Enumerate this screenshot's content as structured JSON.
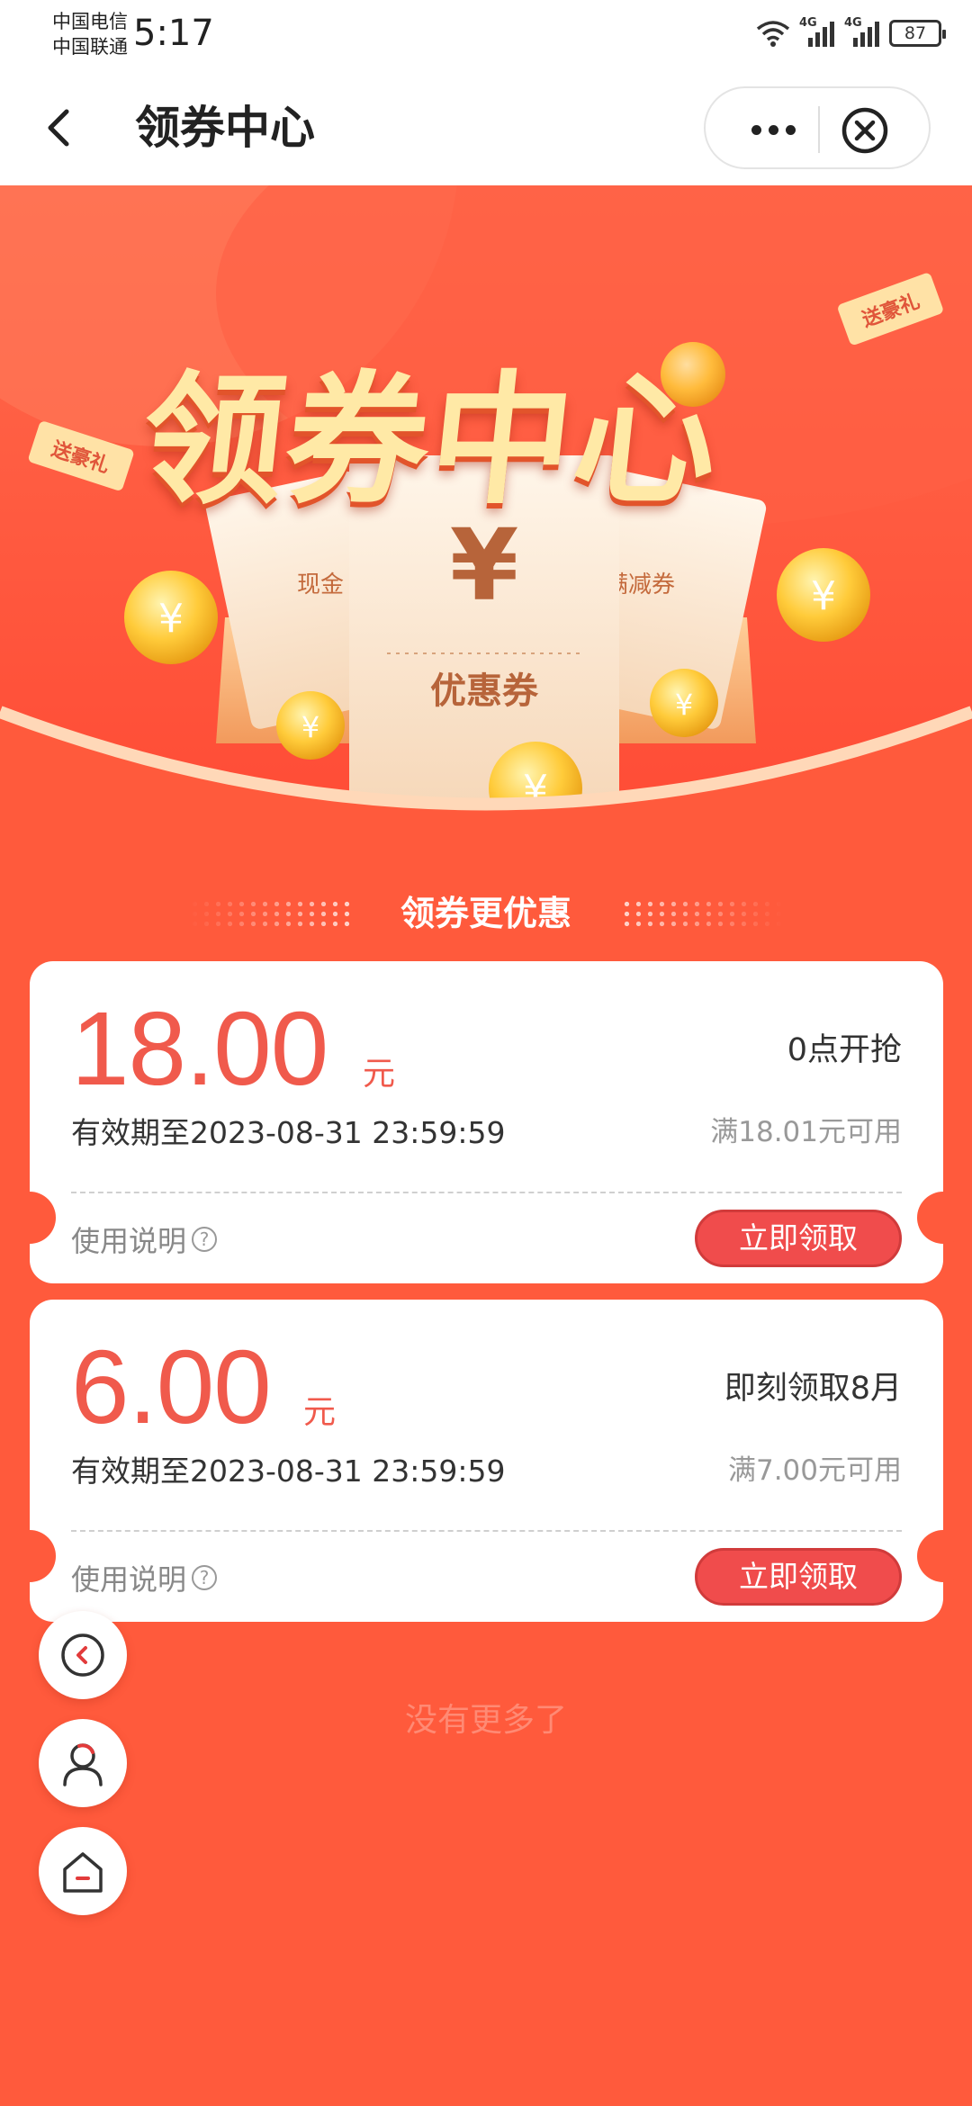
{
  "status_bar": {
    "carrier_1": "中国电信",
    "carrier_2": "中国联通",
    "time": "5:17",
    "network_1": "4G",
    "network_2": "4G",
    "battery": "87"
  },
  "navbar": {
    "title": "领券中心"
  },
  "hero": {
    "title": "领券中心",
    "ticket_left": "现金",
    "ticket_center_symbol": "¥",
    "ticket_center_label": "优惠券",
    "ticket_right": "满减券",
    "ribbon_left": "送豪礼",
    "ribbon_right": "送豪礼"
  },
  "section": {
    "heading": "领券更优惠"
  },
  "coupons": [
    {
      "amount": "18.00",
      "unit": "元",
      "status": "0点开抢",
      "validity": "有效期至2023-08-31 23:59:59",
      "threshold": "满18.01元可用",
      "usage_label": "使用说明",
      "usage_icon": "?",
      "button": "立即领取"
    },
    {
      "amount": "6.00",
      "unit": "元",
      "status": "即刻领取8月",
      "validity": "有效期至2023-08-31 23:59:59",
      "threshold": "满7.00元可用",
      "usage_label": "使用说明",
      "usage_icon": "?",
      "button": "立即领取"
    }
  ],
  "footer": {
    "no_more": "没有更多了"
  },
  "floating_buttons": [
    "back-circle-icon",
    "user-icon",
    "home-icon"
  ],
  "colors": {
    "primary": "#ff5a3c",
    "amount": "#f05a4c",
    "button": "#f04c4c"
  }
}
